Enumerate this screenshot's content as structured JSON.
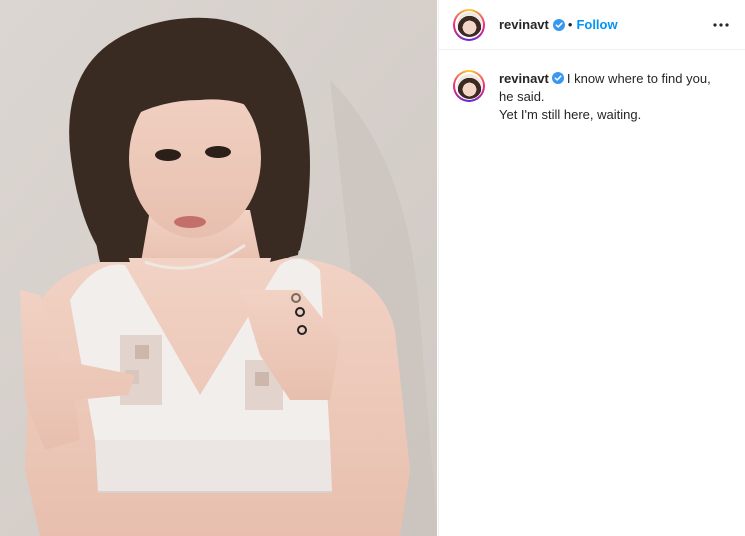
{
  "post": {
    "username": "revinavt",
    "follow_label": "Follow",
    "separator": "•",
    "caption_lines": [
      "I know where to find you,",
      "he said.",
      "Yet I'm still here, waiting."
    ]
  },
  "icons": {
    "verified": "verified-badge-icon",
    "more": "more-options-icon"
  },
  "colors": {
    "accent": "#0095f6",
    "text": "#262626",
    "divider": "#efefef"
  }
}
